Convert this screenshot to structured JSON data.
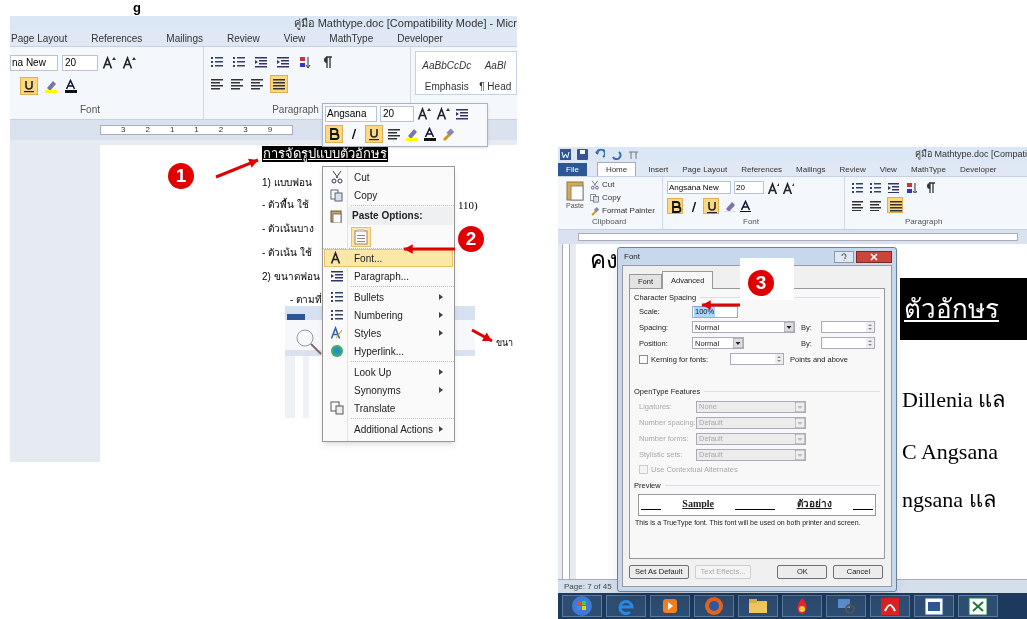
{
  "heading_fragment": "g",
  "left_window": {
    "title": "คู่มือ Mathtype.doc [Compatibility Mode] - Micr",
    "tabs": [
      {
        "label": "Page Layout",
        "selected": false
      },
      {
        "label": "References",
        "selected": false
      },
      {
        "label": "Mailings",
        "selected": false
      },
      {
        "label": "Review",
        "selected": false
      },
      {
        "label": "View",
        "selected": false
      },
      {
        "label": "MathType",
        "selected": false
      },
      {
        "label": "Developer",
        "selected": false
      }
    ],
    "font_name": "na New",
    "font_size": "20",
    "group_labels": [
      "Font",
      "Paragraph"
    ],
    "styles": [
      {
        "sample": "AaBbCcDc",
        "label": "Emphasis"
      },
      {
        "sample": "AaBl",
        "label": "¶ Head"
      }
    ],
    "ruler_numbers": [
      "3",
      "2",
      "1",
      "1",
      "2",
      "3",
      "9"
    ]
  },
  "mini_toolbar": {
    "font": "Angsana",
    "size": "20"
  },
  "document": {
    "title": "การจัดรูปแบบตัวอักษร",
    "lines": [
      "1)  แบบฟอน",
      "-  ตัวพื้น  ใช้",
      "-  ตัวเน้นบาง",
      "-  ตัวเน้น  ใช้",
      "2)  ขนาดฟอน",
      "- ตามที่"
    ],
    "fragment": "110)",
    "callout": "ขนา"
  },
  "context_menu": [
    {
      "kind": "item",
      "label": "Cut",
      "submenu": false,
      "selected": false
    },
    {
      "kind": "item",
      "label": "Copy",
      "submenu": false,
      "selected": false
    },
    {
      "kind": "header",
      "label": "Paste Options:"
    },
    {
      "kind": "paste"
    },
    {
      "kind": "item",
      "label": "Font...",
      "submenu": false,
      "selected": true
    },
    {
      "kind": "item",
      "label": "Paragraph...",
      "submenu": false,
      "selected": false
    },
    {
      "kind": "item",
      "label": "Bullets",
      "submenu": true,
      "selected": false
    },
    {
      "kind": "item",
      "label": "Numbering",
      "submenu": true,
      "selected": false
    },
    {
      "kind": "item",
      "label": "Styles",
      "submenu": true,
      "selected": false
    },
    {
      "kind": "item",
      "label": "Hyperlink...",
      "submenu": false,
      "selected": false
    },
    {
      "kind": "item",
      "label": "Look Up",
      "submenu": true,
      "selected": false
    },
    {
      "kind": "item",
      "label": "Synonyms",
      "submenu": true,
      "selected": false
    },
    {
      "kind": "item",
      "label": "Translate",
      "submenu": false,
      "selected": false
    },
    {
      "kind": "item",
      "label": "Additional Actions",
      "submenu": true,
      "selected": false
    }
  ],
  "markers": [
    "1",
    "2",
    "3"
  ],
  "right_window": {
    "title": "คู่มือ Mathtype.doc [Compati",
    "tabs": [
      {
        "label": "File",
        "selected": false
      },
      {
        "label": "Home",
        "selected": true
      },
      {
        "label": "Insert",
        "selected": false
      },
      {
        "label": "Page Layout",
        "selected": false
      },
      {
        "label": "References",
        "selected": false
      },
      {
        "label": "Mailings",
        "selected": false
      },
      {
        "label": "Review",
        "selected": false
      },
      {
        "label": "View",
        "selected": false
      },
      {
        "label": "MathType",
        "selected": false
      },
      {
        "label": "Developer",
        "selected": false
      }
    ],
    "paste": "Paste",
    "clipboard": [
      "Cut",
      "Copy",
      "Format Painter"
    ],
    "font_name": "Angsana New",
    "font_size": "20",
    "group_labels": [
      "Clipboard",
      "Font",
      "Paragraph"
    ],
    "document": {
      "top": "คง",
      "banner": "ตัวอักษร",
      "lines": [
        "Dillenia  แล",
        "C  Angsana",
        "ngsana  แล"
      ]
    },
    "status": "Page: 7 of 45"
  },
  "font_dialog": {
    "title": "Font",
    "tabs": [
      {
        "label": "Font",
        "selected": false
      },
      {
        "label": "Advanced",
        "selected": true
      }
    ],
    "spacing_section": "Character Spacing",
    "scale": {
      "label": "Scale:",
      "value": "100%"
    },
    "spacing": {
      "label": "Spacing:",
      "value": "Normal",
      "by": "By:"
    },
    "position": {
      "label": "Position:",
      "value": "Normal",
      "by": "By:"
    },
    "kerning": {
      "label": "Kerning for fonts:",
      "checked": false,
      "suffix": "Points and above"
    },
    "opentype_section": "OpenType Features",
    "opentype": [
      {
        "label": "Ligatures:",
        "value": "None"
      },
      {
        "label": "Number spacing:",
        "value": "Default"
      },
      {
        "label": "Number forms:",
        "value": "Default"
      },
      {
        "label": "Stylistic sets:",
        "value": "Default"
      }
    ],
    "contextual": {
      "label": "Use Contextual Alternates",
      "checked": false,
      "disabled": true
    },
    "preview_section": "Preview",
    "preview_samples": [
      "Sample",
      "ตัวอย่าง"
    ],
    "note": "This is a TrueType font. This font will be used on both printer and screen.",
    "buttons": [
      {
        "label": "Set As Default",
        "disabled": false
      },
      {
        "label": "Text Effects...",
        "disabled": true
      },
      {
        "label": "OK",
        "disabled": false
      },
      {
        "label": "Cancel",
        "disabled": false
      }
    ]
  }
}
